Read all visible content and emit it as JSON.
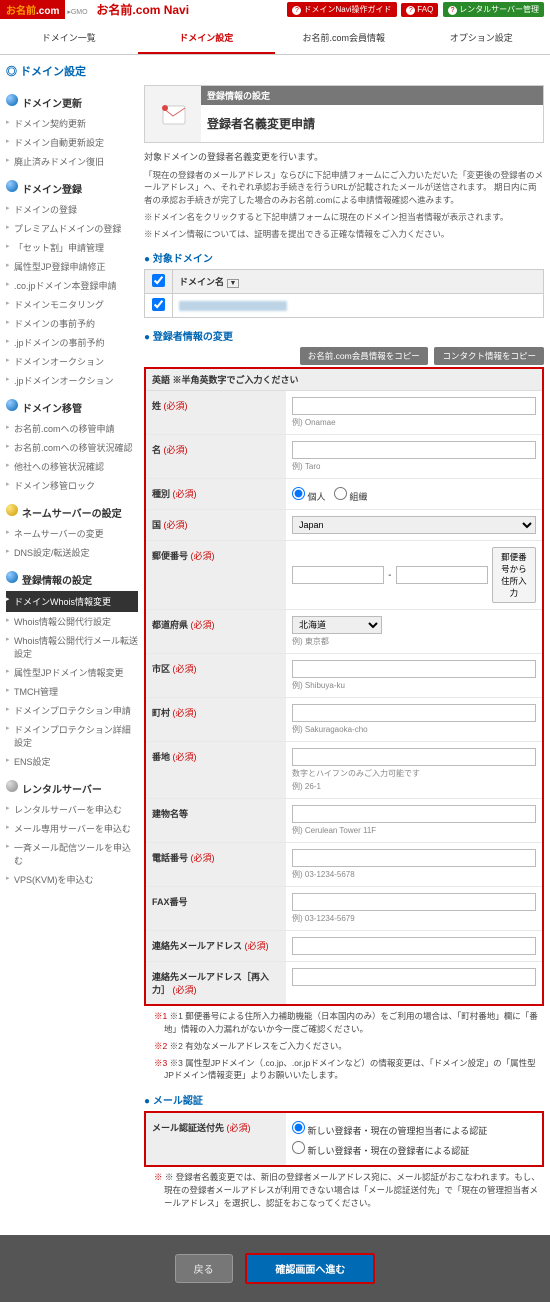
{
  "header": {
    "logo_pre": "お名前",
    "logo_dot": ".com",
    "logo_sub": "▸GMO",
    "navi_title": "お名前.com Navi",
    "btn_guide": "ドメインNavi操作ガイド",
    "btn_faq": "FAQ",
    "btn_rental": "レンタルサーバー管理"
  },
  "tabs": {
    "t1": "ドメイン一覧",
    "t2": "ドメイン設定",
    "t3": "お名前.com会員情報",
    "t4": "オプション設定"
  },
  "section_title": "ドメイン設定",
  "sidebar": {
    "g1": {
      "title": "ドメイン更新",
      "items": [
        "ドメイン契約更新",
        "ドメイン自動更新設定",
        "廃止済みドメイン復旧"
      ]
    },
    "g2": {
      "title": "ドメイン登録",
      "items": [
        "ドメインの登録",
        "プレミアムドメインの登録",
        "「セット割」申請管理",
        "属性型JP登録申請修正",
        ".co.jpドメイン本登録申請",
        "ドメインモニタリング",
        "ドメインの事前予約",
        ".jpドメインの事前予約",
        "ドメインオークション",
        ".jpドメインオークション"
      ]
    },
    "g3": {
      "title": "ドメイン移管",
      "items": [
        "お名前.comへの移管申請",
        "お名前.comへの移管状況確認",
        "他社への移管状況確認",
        "ドメイン移管ロック"
      ]
    },
    "g4": {
      "title": "ネームサーバーの設定",
      "items": [
        "ネームサーバーの変更",
        "DNS設定/転送設定"
      ]
    },
    "g5": {
      "title": "登録情報の設定",
      "items": [
        "ドメインWhois情報変更",
        "Whois情報公開代行設定",
        "Whois情報公開代行メール転送設定",
        "属性型JPドメイン情報変更",
        "TMCH管理",
        "ドメインプロテクション申請",
        "ドメインプロテクション詳細設定",
        "ENS設定"
      ]
    },
    "g6": {
      "title": "レンタルサーバー",
      "items": [
        "レンタルサーバーを申込む",
        "メール専用サーバーを申込む",
        "一斉メール配信ツールを申込む",
        "VPS(KVM)を申込む"
      ]
    }
  },
  "card": {
    "t1": "登録情報の設定",
    "t2": "登録者名義変更申請"
  },
  "intro": {
    "p1": "対象ドメインの登録者名義変更を行います。",
    "p2": "「現在の登録者のメールアドレス」ならびに下記申請フォームにご入力いただいた「変更後の登録者のメールアドレス」へ、それぞれ承認お手続きを行うURLが記載されたメールが送信されます。 期日内に両者の承認お手続きが完了した場合のみお名前.comによる申請情報確認へ進みます。",
    "p3": "※ドメイン名をクリックすると下記申請フォームに現在のドメイン担当者情報が表示されます。",
    "p4": "※ドメイン情報については、証明書を提出できる正確な情報をご入力ください。"
  },
  "h_target": "対象ドメイン",
  "dom_hdr": "ドメイン名",
  "dom_val": "xxxxxxx.xxx",
  "h_change": "登録者情報の変更",
  "copy1": "お名前.com会員情報をコピー",
  "copy2": "コンタクト情報をコピー",
  "form": {
    "note": "英語 ※半角英数字でご入力ください",
    "sei": {
      "label": "姓",
      "req": "(必須)",
      "hint": "例) Onamae"
    },
    "mei": {
      "label": "名",
      "req": "(必須)",
      "hint": "例) Taro"
    },
    "kind": {
      "label": "種別",
      "req": "(必須)",
      "o1": "個人",
      "o2": "組織"
    },
    "country": {
      "label": "国",
      "req": "(必須)",
      "val": "Japan"
    },
    "postal": {
      "label": "郵便番号",
      "req": "(必須)",
      "btn": "郵便番号から住所入力"
    },
    "pref": {
      "label": "都道府県",
      "req": "(必須)",
      "val": "北海道",
      "hint": "例) 東京都"
    },
    "city": {
      "label": "市区",
      "req": "(必須)",
      "hint": "例) Shibuya-ku"
    },
    "town": {
      "label": "町村",
      "req": "(必須)",
      "hint": "例) Sakuragaoka-cho"
    },
    "addr": {
      "label": "番地",
      "req": "(必須)",
      "hint1": "数字とハイフンのみご入力可能です",
      "hint2": "例) 26-1"
    },
    "bldg": {
      "label": "建物名等",
      "hint": "例) Cerulean Tower 11F"
    },
    "tel": {
      "label": "電話番号",
      "req": "(必須)",
      "hint": "例) 03-1234-5678"
    },
    "fax": {
      "label": "FAX番号",
      "hint": "例) 03-1234-5679"
    },
    "mail": {
      "label": "連絡先メールアドレス",
      "req": "(必須)"
    },
    "mail2": {
      "label": "連絡先メールアドレス［再入力］",
      "req": "(必須)"
    }
  },
  "notes": {
    "n1": "※1 郵便番号による住所入力補助機能（日本国内のみ）をご利用の場合は、「町村番地」欄に「番地」情報の入力漏れがないか今一度ご確認ください。",
    "n2": "※2 有効なメールアドレスをご入力ください。",
    "n3": "※3 属性型JPドメイン（.co.jp、.or.jpドメインなど）の情報変更は、「ドメイン設定」の「属性型JPドメイン情報変更」よりお願いいたします。"
  },
  "h_mail": "メール認証",
  "auth": {
    "label": "メール認証送付先",
    "req": "(必須)",
    "o1": "新しい登録者・現在の管理担当者による認証",
    "o2": "新しい登録者・現在の登録者による認証"
  },
  "auth_note": "※ 登録者名義変更では、新旧の登録者メールアドレス宛に、メール認証がおこなわれます。もし、現在の登録者メールアドレスが利用できない場合は「メール認証送付先」で「現在の管理担当者メールアドレス」を選択し、認証をおこなってください。",
  "btn_back": "戻る",
  "btn_next": "確認画面へ進む"
}
